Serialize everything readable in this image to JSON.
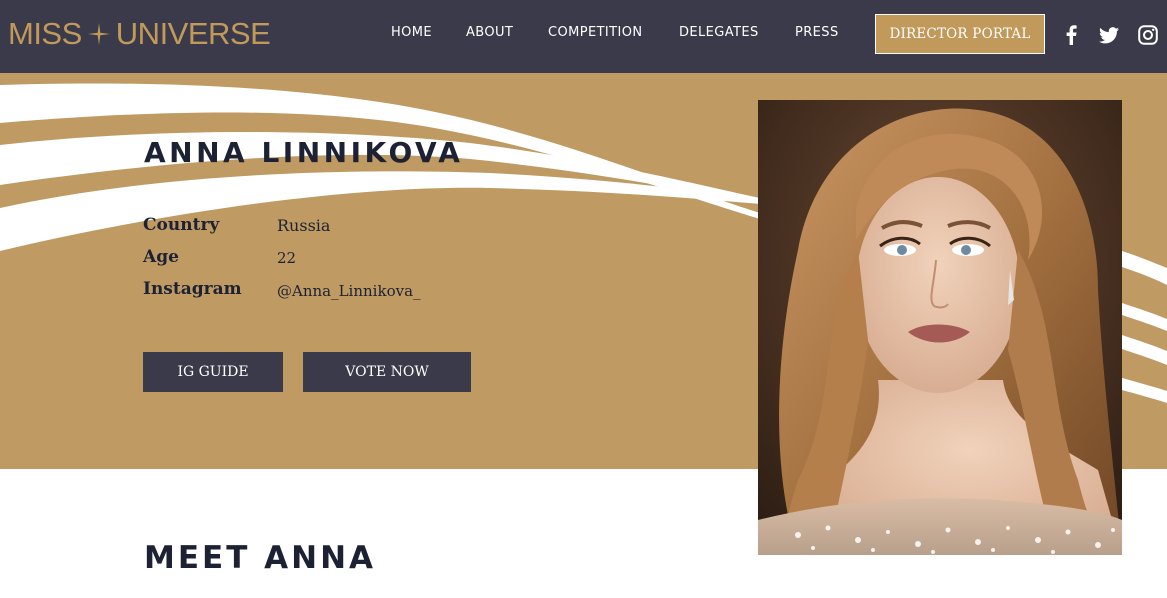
{
  "brand": {
    "logo_left": "MISS",
    "logo_right": "UNIVERSE",
    "accent": "#c19a5b",
    "header_bg": "#3a3a4a"
  },
  "nav": {
    "items": [
      {
        "label": "HOME"
      },
      {
        "label": "ABOUT"
      },
      {
        "label": "COMPETITION"
      },
      {
        "label": "DELEGATES"
      },
      {
        "label": "PRESS"
      }
    ],
    "director_portal": "DIRECTOR PORTAL",
    "social": [
      "facebook-icon",
      "twitter-icon",
      "instagram-icon"
    ]
  },
  "hero": {
    "name": "ANNA LINNIKOVA",
    "background": "#bf9a62",
    "info": [
      {
        "label": "Country",
        "value": "Russia"
      },
      {
        "label": "Age",
        "value": "22"
      },
      {
        "label": "Instagram",
        "value": "@Anna_Linnikova_"
      }
    ],
    "buttons": {
      "ig_guide": "IG GUIDE",
      "vote_now": "VOTE NOW"
    }
  },
  "meet": {
    "title": "MEET ANNA"
  }
}
